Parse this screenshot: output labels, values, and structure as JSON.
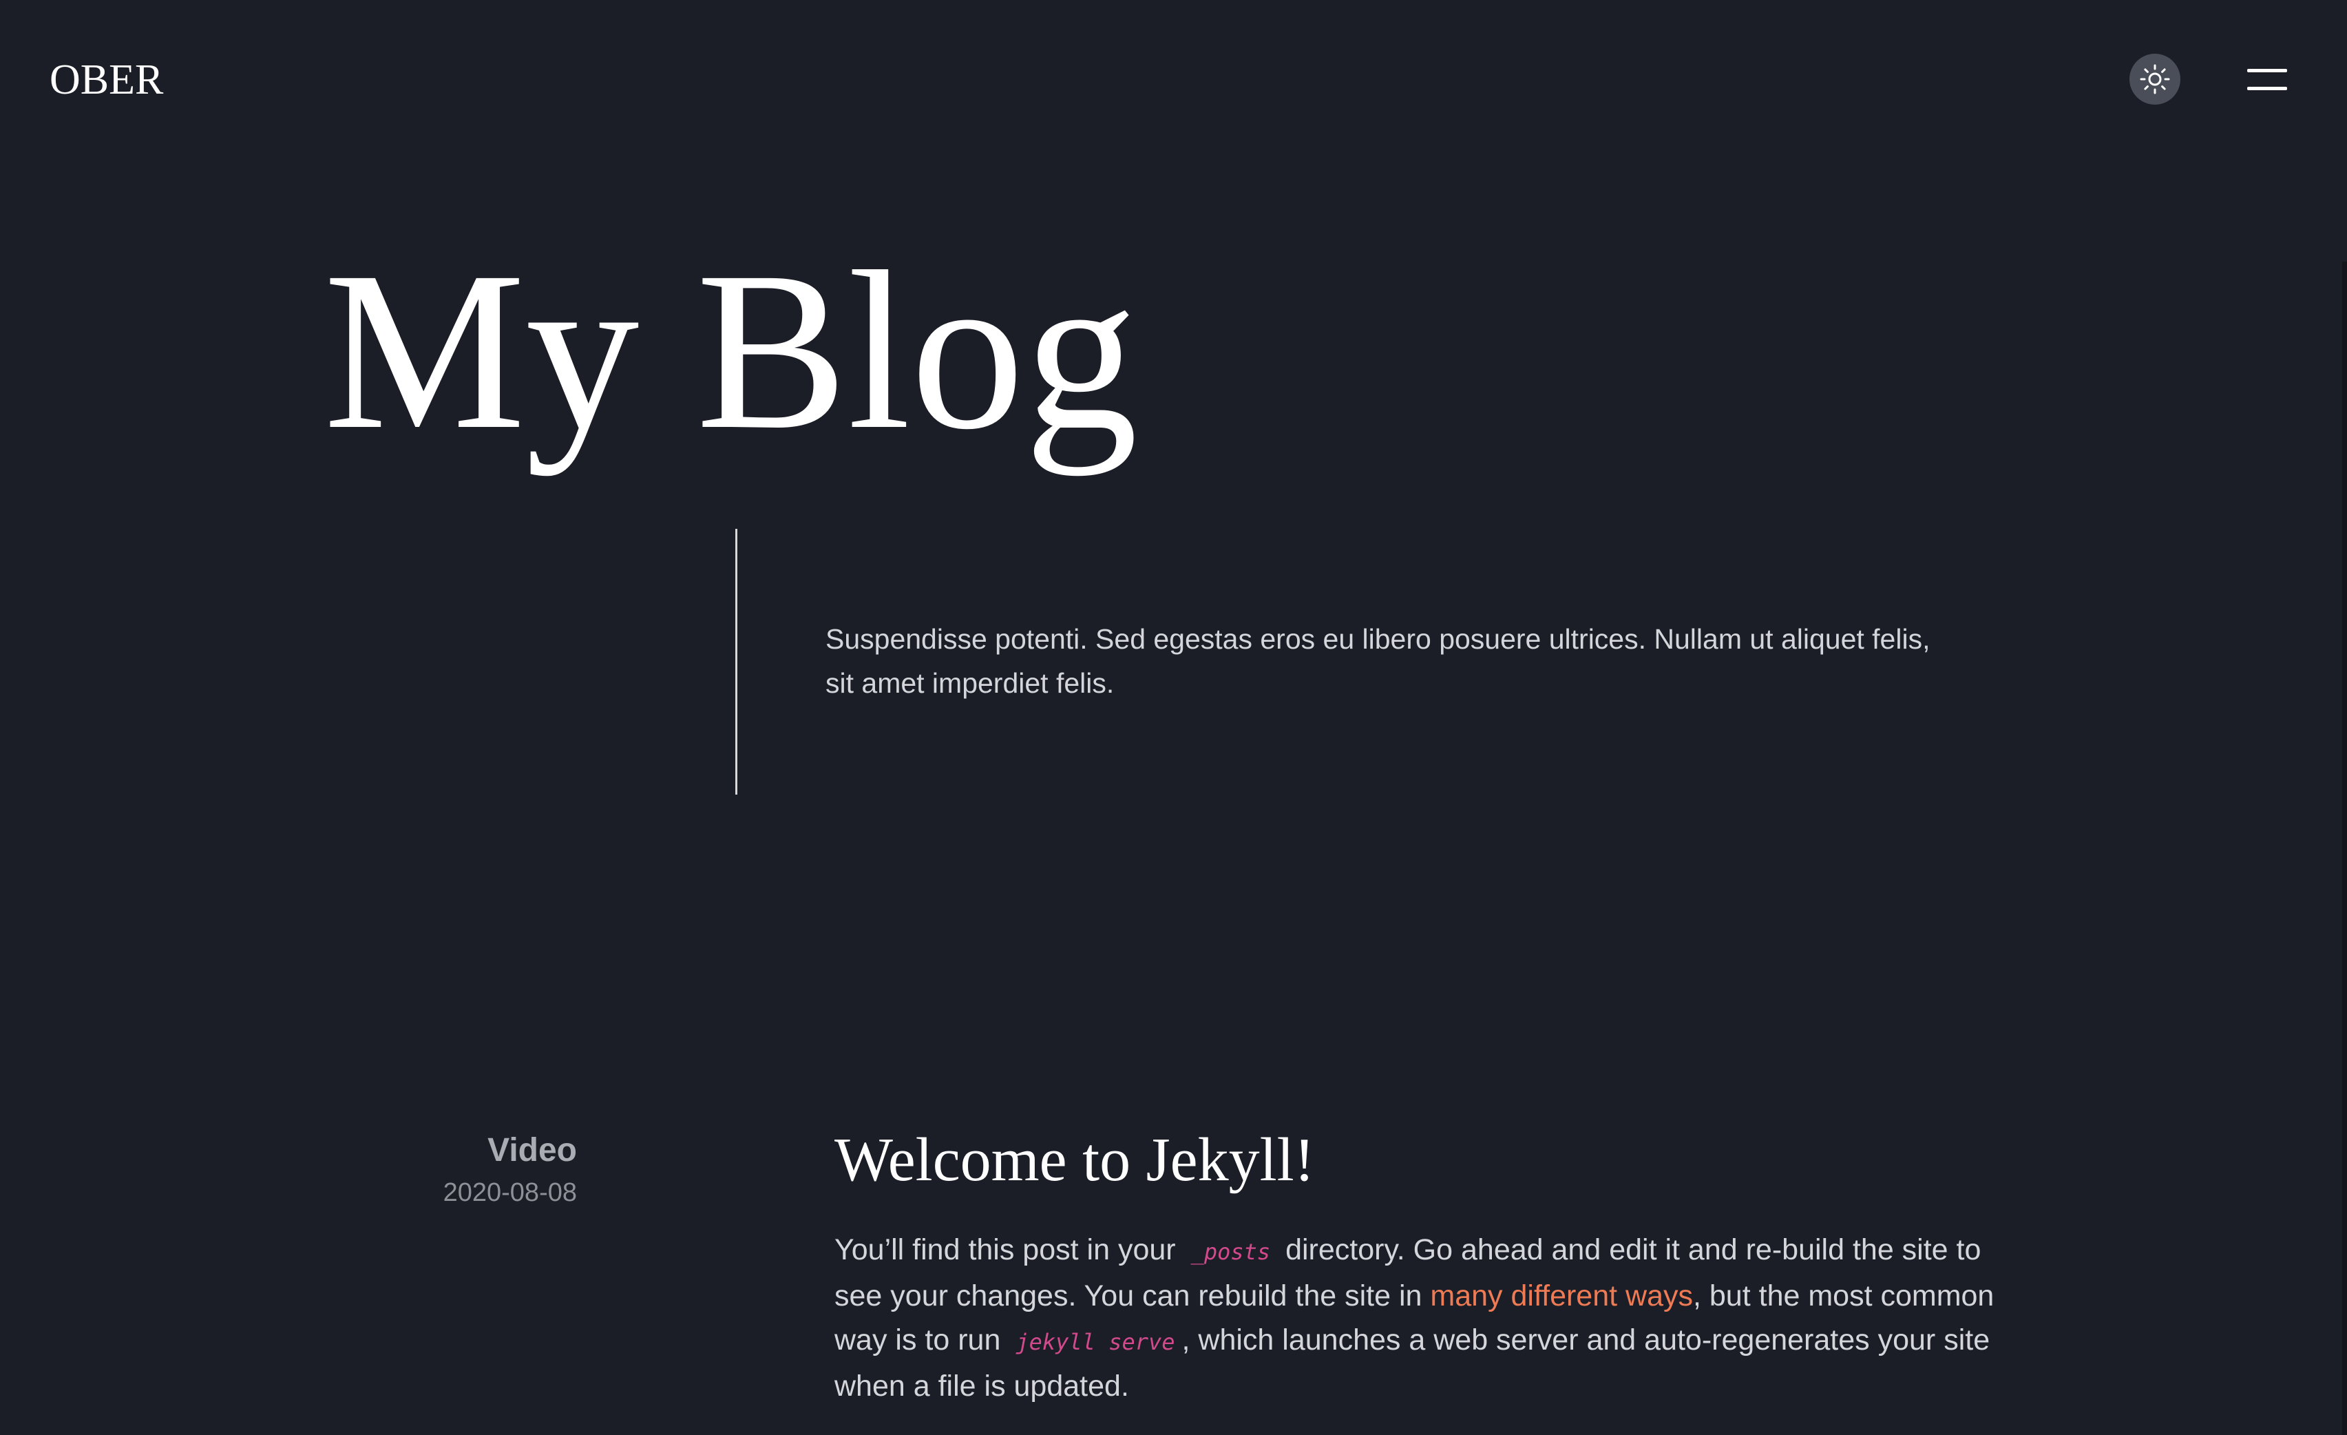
{
  "header": {
    "logo": "OBER",
    "theme_toggle_icon": "sun-icon",
    "menu_icon": "hamburger-menu-icon"
  },
  "hero": {
    "title": "My Blog",
    "description": "Suspendisse potenti. Sed egestas eros eu libero posuere ultrices. Nullam ut aliquet felis, sit amet imperdiet felis."
  },
  "post": {
    "category": "Video",
    "date": "2020-08-08",
    "title": "Welcome to Jekyll!",
    "excerpt": {
      "part1": "You’ll find this post in your",
      "code1": "_posts",
      "part2": "directory. Go ahead and edit it and re-build the site to see your changes. You can rebuild the site in",
      "link": "many different ways",
      "part3": ", but the most common way is to run",
      "code2": "jekyll serve",
      "part4": ", which launches a web server and auto-regenerates your site when a file is updated."
    }
  },
  "colors": {
    "background": "#1b1e27",
    "text": "#d4d6db",
    "heading": "#ffffff",
    "code": "#d24a8c",
    "link": "#ef7b55",
    "muted": "#a9acb3",
    "toggle_bg": "#4a4e58"
  }
}
